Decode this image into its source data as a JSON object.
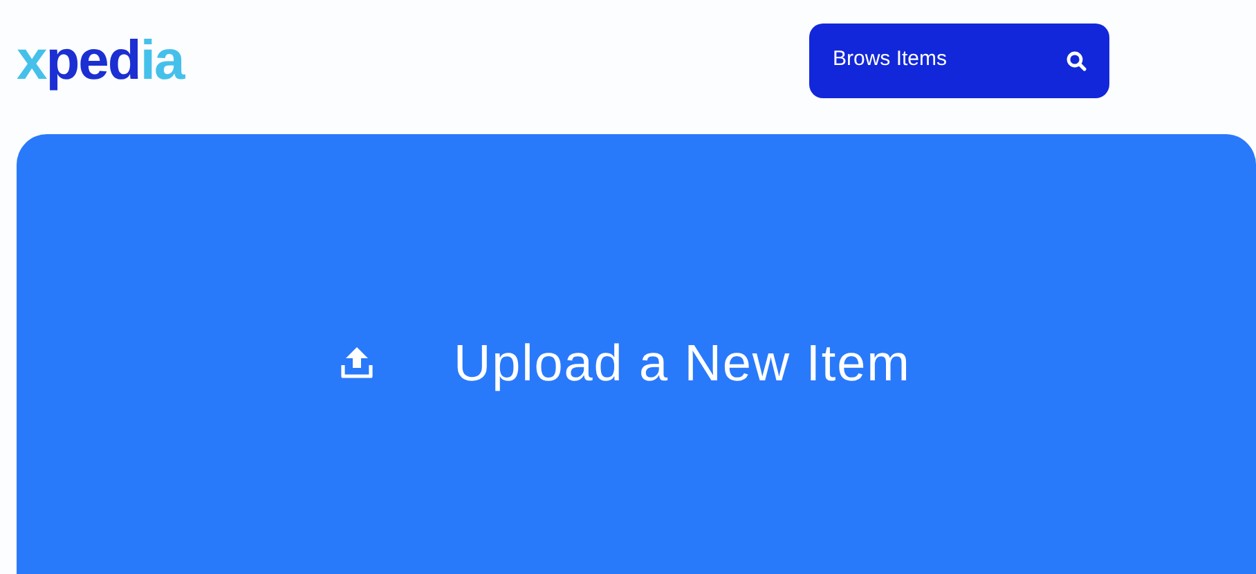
{
  "logo": {
    "parts": [
      {
        "text": "x",
        "color": "#45c0ea"
      },
      {
        "text": "ped",
        "color": "#1c2fd2"
      },
      {
        "text": "ia",
        "color": "#45c0ea"
      }
    ]
  },
  "browse_button": {
    "label": "Brows Items"
  },
  "upload_panel": {
    "label": "Upload a New Item"
  }
}
